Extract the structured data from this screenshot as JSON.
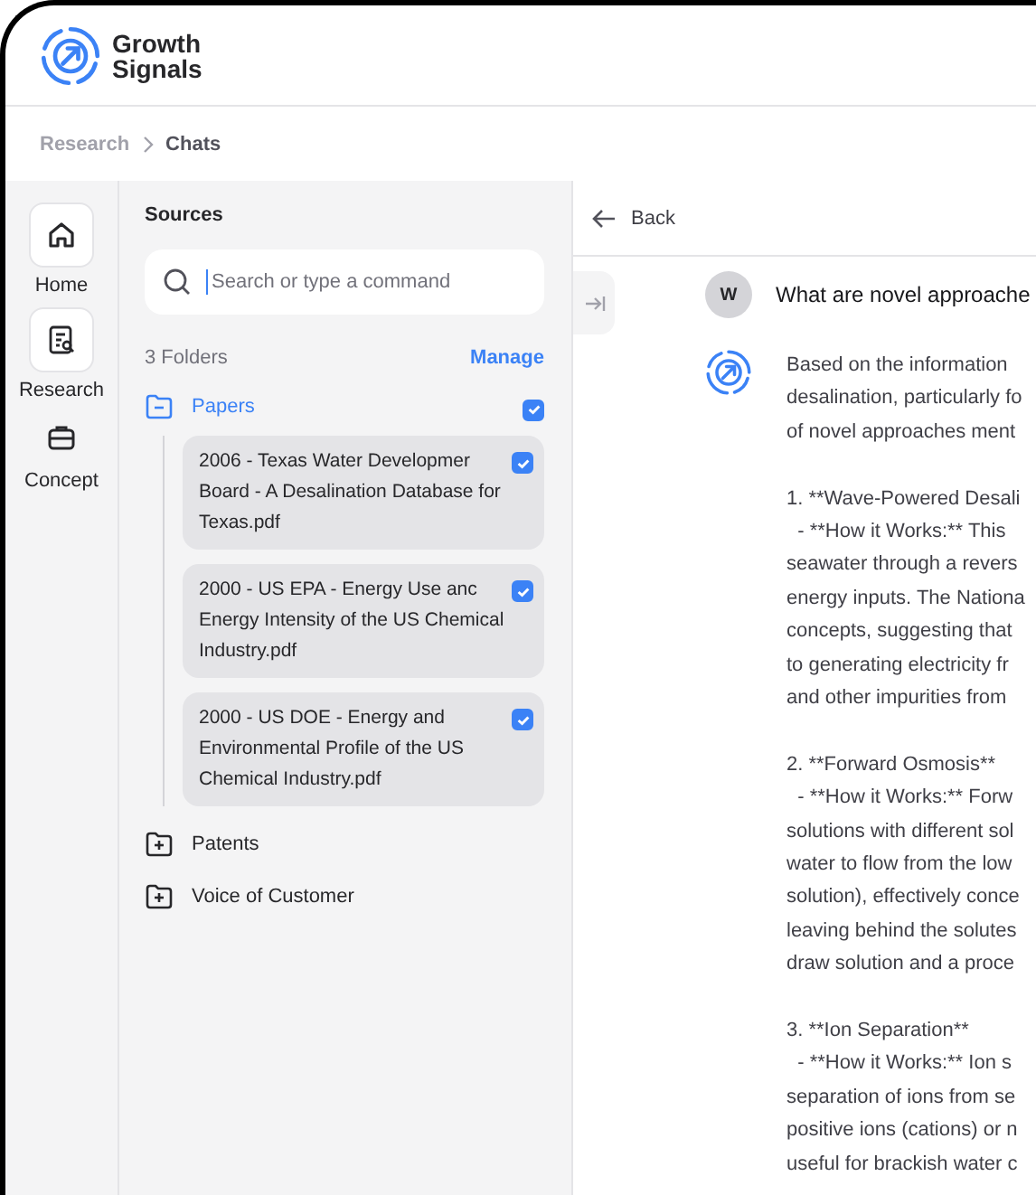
{
  "brand": {
    "name_line1": "Growth",
    "name_line2": "Signals"
  },
  "breadcrumb": [
    {
      "label": "Research",
      "selected": false
    },
    {
      "label": "Chats",
      "selected": true
    }
  ],
  "nav": [
    {
      "label": "Home",
      "kind": "home"
    },
    {
      "label": "Research",
      "kind": "research"
    },
    {
      "label": "Concept",
      "kind": "concept"
    }
  ],
  "sources": {
    "title": "Sources",
    "search": {
      "placeholder": "Search or type a command"
    },
    "folder_count": "3 Folders",
    "manage": "Manage",
    "folders": [
      {
        "name": "Papers",
        "expanded": true,
        "checked": true,
        "files": [
          {
            "name": "2006 - Texas Water Developmer Board - A Desalination Database for Texas.pdf",
            "checked": true
          },
          {
            "name": "2000 - US EPA - Energy Use anc Energy Intensity of the US Chemical Industry.pdf",
            "checked": true
          },
          {
            "name": "2000 - US DOE - Energy and Environmental Profile of the US Chemical Industry.pdf",
            "checked": true
          }
        ]
      },
      {
        "name": "Patents",
        "expanded": false
      },
      {
        "name": "Voice of Customer",
        "expanded": false
      }
    ]
  },
  "chat": {
    "back": "Back",
    "question": {
      "avatar": "W",
      "text": "What are novel approache"
    },
    "answer": [
      {
        "lines": [
          "Based on the information",
          "desalination, particularly fo",
          "of novel approaches ment"
        ]
      },
      {
        "lines": [
          "1. **Wave-Powered Desali",
          "  - **How it Works:** This",
          "seawater through a revers",
          "energy inputs. The Nationa",
          "concepts, suggesting that",
          "to generating electricity fr",
          "and other impurities from"
        ]
      },
      {
        "lines": [
          "2. **Forward Osmosis**",
          "  - **How it Works:** Forw",
          "solutions with different sol",
          "water to flow from the low",
          "solution), effectively conce",
          "leaving behind the solutes",
          "draw solution and a proce"
        ]
      },
      {
        "lines": [
          "3. **Ion Separation**",
          "  - **How it Works:** Ion s",
          "separation of ions from se",
          "positive ions (cations) or n",
          "useful for brackish water c"
        ]
      }
    ]
  }
}
